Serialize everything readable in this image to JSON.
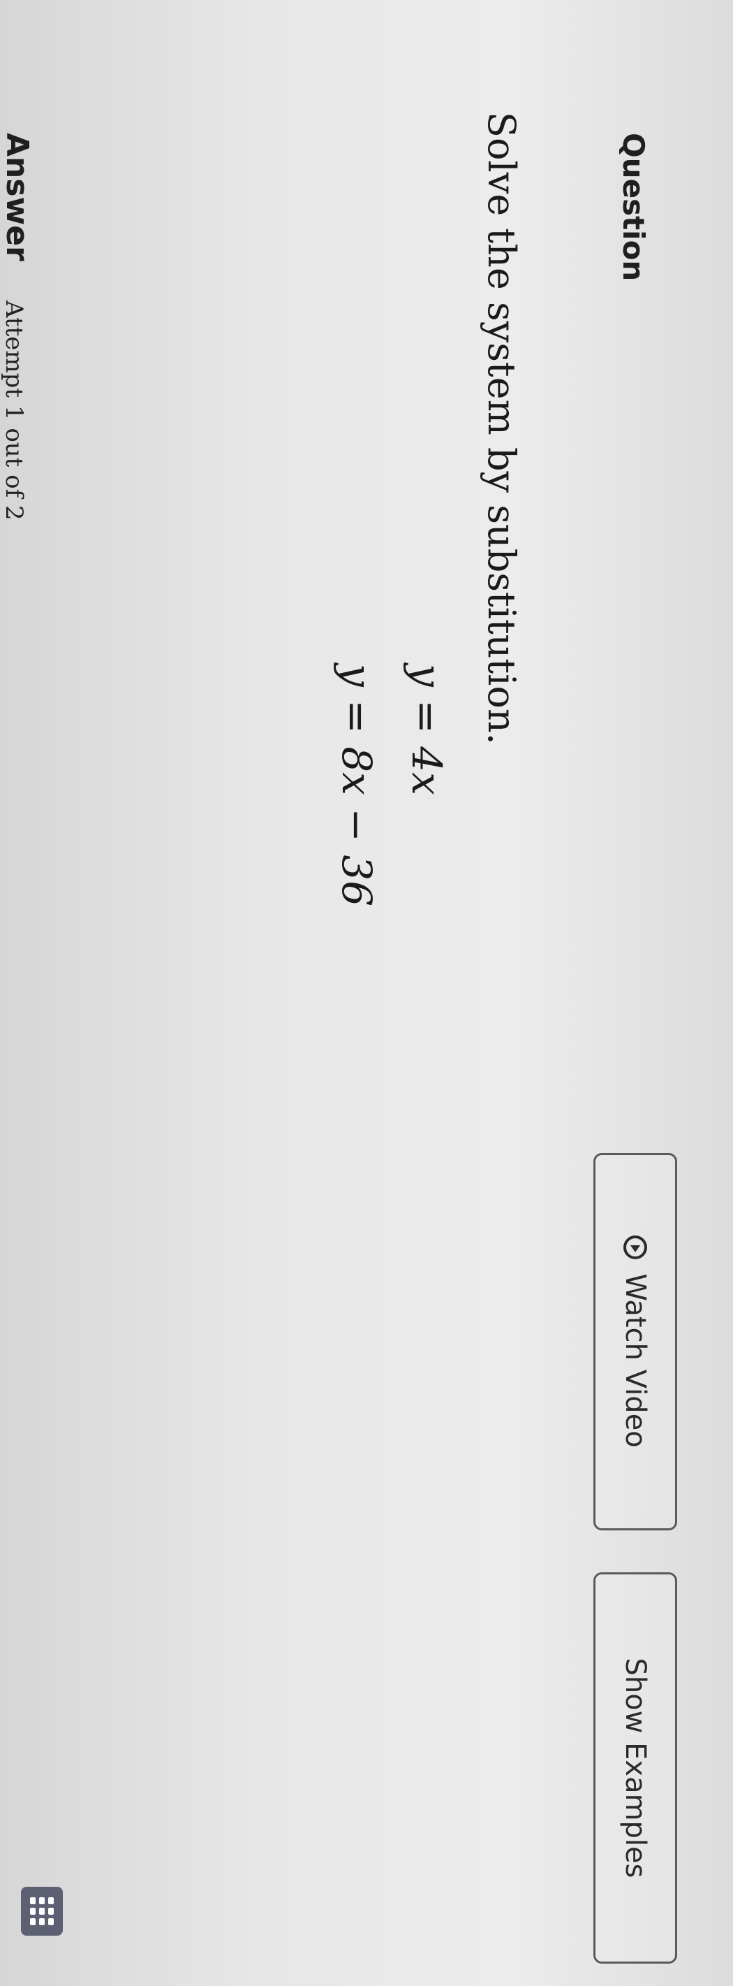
{
  "header": {
    "title": "Question",
    "watch_video_label": "Watch Video",
    "show_examples_label": "Show Examples"
  },
  "question": {
    "prompt": "Solve the system by substitution.",
    "equations": [
      "y = 4x",
      "y = 8x − 36"
    ]
  },
  "answer": {
    "label": "Answer",
    "attempt_text": "Attempt 1 out of 2"
  },
  "icons": {
    "video": "play-circle-icon",
    "keypad": "keypad-icon"
  }
}
